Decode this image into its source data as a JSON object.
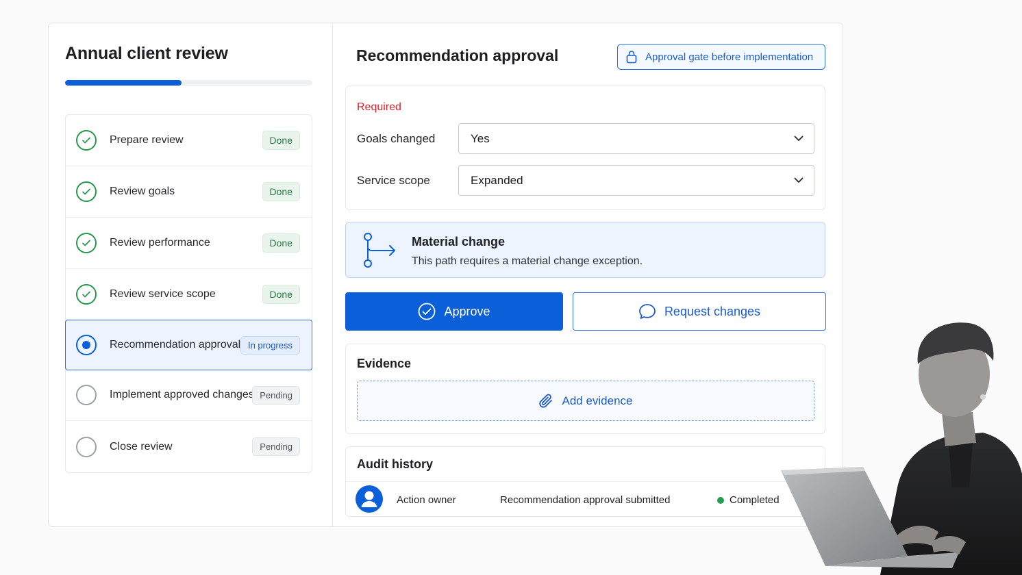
{
  "sidebar": {
    "title": "Annual client review",
    "progress_fraction": 0.47,
    "steps": [
      {
        "label": "Prepare review",
        "status": "Done",
        "state": "done"
      },
      {
        "label": "Review goals",
        "status": "Done",
        "state": "done"
      },
      {
        "label": "Review performance",
        "status": "Done",
        "state": "done"
      },
      {
        "label": "Review service scope",
        "status": "Done",
        "state": "done"
      },
      {
        "label": "Recommendation approval",
        "status": "In progress",
        "state": "in-progress"
      },
      {
        "label": "Implement approved changes",
        "status": "Pending",
        "state": "pending"
      },
      {
        "label": "Close review",
        "status": "Pending",
        "state": "pending"
      }
    ]
  },
  "main": {
    "title": "Recommendation approval",
    "gate_button": "Approval gate before implementation",
    "required_label": "Required",
    "fields": [
      {
        "label": "Goals changed",
        "value": "Yes"
      },
      {
        "label": "Service scope",
        "value": "Expanded"
      }
    ],
    "notice": {
      "title": "Material change",
      "description": "This path requires a material change exception."
    },
    "approve_label": "Approve",
    "request_label": "Request changes",
    "evidence": {
      "title": "Evidence",
      "add_label": "Add evidence"
    },
    "audit": {
      "title": "Audit history",
      "rows": [
        {
          "owner": "Action owner",
          "event": "Recommendation approval submitted",
          "status": "Completed"
        }
      ]
    }
  },
  "colors": {
    "accent": "#0b5fd9",
    "done": "#27984c",
    "required": "#d8232a",
    "completed_dot": "#22a050"
  },
  "icons": {
    "step_done": "check-circle-icon",
    "step_active": "radio-filled-icon",
    "step_pending": "empty-circle-icon",
    "gate": "lock-icon",
    "select": "chevron-down-icon",
    "notice": "branch-arrow-icon",
    "approve": "check-circle-icon",
    "request": "chat-bubble-icon",
    "evidence": "paperclip-icon",
    "avatar": "user-icon"
  }
}
